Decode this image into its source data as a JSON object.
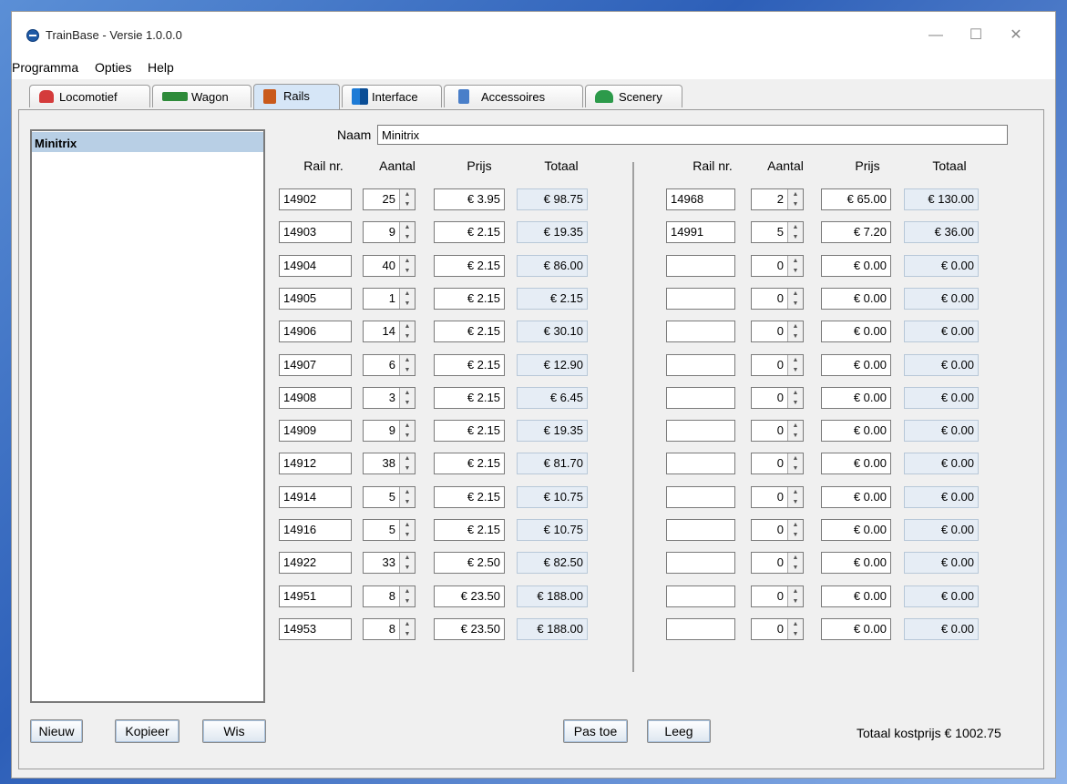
{
  "window": {
    "title": "TrainBase - Versie 1.0.0.0",
    "controls": [
      "—",
      "☐",
      "✕"
    ]
  },
  "menu": [
    "Programma",
    "Opties",
    "Help"
  ],
  "tabs": [
    {
      "label": "Locomotief",
      "icon": "locomotive-icon",
      "color": "#d43b3b"
    },
    {
      "label": "Wagon",
      "icon": "wagon-icon",
      "color": "#2e8b3a"
    },
    {
      "label": "Rails",
      "icon": "rails-icon",
      "color": "#c95a1c"
    },
    {
      "label": "Interface",
      "icon": "interface-icon",
      "color": "#1d7bd6"
    },
    {
      "label": "Accessoires",
      "icon": "accessories-icon",
      "color": "#4a7fc9"
    },
    {
      "label": "Scenery",
      "icon": "scenery-icon",
      "color": "#2c9a4a"
    }
  ],
  "active_tab": "Rails",
  "list": {
    "items": [
      "Minitrix"
    ]
  },
  "form": {
    "naam_label": "Naam",
    "naam_value": "Minitrix",
    "headers": [
      "Rail nr.",
      "Aantal",
      "Prijs",
      "Totaal"
    ]
  },
  "left_rows": [
    {
      "rail": "14902",
      "aantal": "25",
      "prijs": "€ 3.95",
      "totaal": "€ 98.75"
    },
    {
      "rail": "14903",
      "aantal": "9",
      "prijs": "€ 2.15",
      "totaal": "€ 19.35"
    },
    {
      "rail": "14904",
      "aantal": "40",
      "prijs": "€ 2.15",
      "totaal": "€ 86.00"
    },
    {
      "rail": "14905",
      "aantal": "1",
      "prijs": "€ 2.15",
      "totaal": "€ 2.15"
    },
    {
      "rail": "14906",
      "aantal": "14",
      "prijs": "€ 2.15",
      "totaal": "€ 30.10"
    },
    {
      "rail": "14907",
      "aantal": "6",
      "prijs": "€ 2.15",
      "totaal": "€ 12.90"
    },
    {
      "rail": "14908",
      "aantal": "3",
      "prijs": "€ 2.15",
      "totaal": "€ 6.45"
    },
    {
      "rail": "14909",
      "aantal": "9",
      "prijs": "€ 2.15",
      "totaal": "€ 19.35"
    },
    {
      "rail": "14912",
      "aantal": "38",
      "prijs": "€ 2.15",
      "totaal": "€ 81.70"
    },
    {
      "rail": "14914",
      "aantal": "5",
      "prijs": "€ 2.15",
      "totaal": "€ 10.75"
    },
    {
      "rail": "14916",
      "aantal": "5",
      "prijs": "€ 2.15",
      "totaal": "€ 10.75"
    },
    {
      "rail": "14922",
      "aantal": "33",
      "prijs": "€ 2.50",
      "totaal": "€ 82.50"
    },
    {
      "rail": "14951",
      "aantal": "8",
      "prijs": "€ 23.50",
      "totaal": "€ 188.00"
    },
    {
      "rail": "14953",
      "aantal": "8",
      "prijs": "€ 23.50",
      "totaal": "€ 188.00"
    }
  ],
  "right_rows": [
    {
      "rail": "14968",
      "aantal": "2",
      "prijs": "€ 65.00",
      "totaal": "€ 130.00"
    },
    {
      "rail": "14991",
      "aantal": "5",
      "prijs": "€ 7.20",
      "totaal": "€ 36.00"
    },
    {
      "rail": "",
      "aantal": "0",
      "prijs": "€ 0.00",
      "totaal": "€ 0.00"
    },
    {
      "rail": "",
      "aantal": "0",
      "prijs": "€ 0.00",
      "totaal": "€ 0.00"
    },
    {
      "rail": "",
      "aantal": "0",
      "prijs": "€ 0.00",
      "totaal": "€ 0.00"
    },
    {
      "rail": "",
      "aantal": "0",
      "prijs": "€ 0.00",
      "totaal": "€ 0.00"
    },
    {
      "rail": "",
      "aantal": "0",
      "prijs": "€ 0.00",
      "totaal": "€ 0.00"
    },
    {
      "rail": "",
      "aantal": "0",
      "prijs": "€ 0.00",
      "totaal": "€ 0.00"
    },
    {
      "rail": "",
      "aantal": "0",
      "prijs": "€ 0.00",
      "totaal": "€ 0.00"
    },
    {
      "rail": "",
      "aantal": "0",
      "prijs": "€ 0.00",
      "totaal": "€ 0.00"
    },
    {
      "rail": "",
      "aantal": "0",
      "prijs": "€ 0.00",
      "totaal": "€ 0.00"
    },
    {
      "rail": "",
      "aantal": "0",
      "prijs": "€ 0.00",
      "totaal": "€ 0.00"
    },
    {
      "rail": "",
      "aantal": "0",
      "prijs": "€ 0.00",
      "totaal": "€ 0.00"
    },
    {
      "rail": "",
      "aantal": "0",
      "prijs": "€ 0.00",
      "totaal": "€ 0.00"
    }
  ],
  "buttons": {
    "nieuw": "Nieuw",
    "kopieer": "Kopieer",
    "wis": "Wis",
    "pas_toe": "Pas toe",
    "leeg": "Leeg"
  },
  "total_label": "Totaal kostprijs € 1002.75"
}
